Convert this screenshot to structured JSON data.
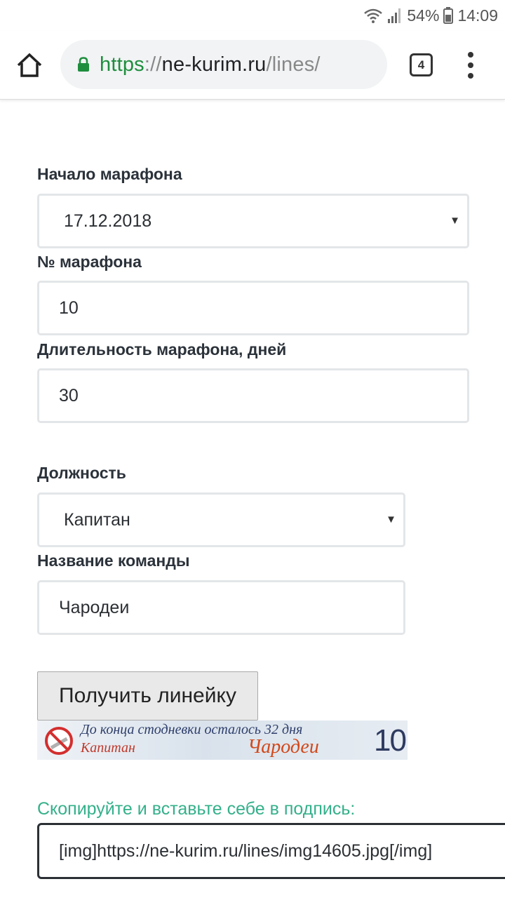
{
  "status_bar": {
    "battery": "54%",
    "time": "14:09"
  },
  "browser": {
    "url_scheme": "https",
    "url_separator": "://",
    "url_host": "ne-kurim.ru",
    "url_path": "/lines/",
    "tab_count": "4"
  },
  "form": {
    "start_label": "Начало марафона",
    "start_value": "17.12.2018",
    "number_label": "№ марафона",
    "number_value": "10",
    "duration_label": "Длительность марафона, дней",
    "duration_value": "30",
    "position_label": "Должность",
    "position_value": "Капитан",
    "team_label": "Название команды",
    "team_value": "Чародеи",
    "submit_label": "Получить линейку"
  },
  "banner": {
    "line1": "До конца стодневки осталось 32 дня",
    "position": "Капитан",
    "team": "Чародеи",
    "number": "10"
  },
  "copy": {
    "hint": "Скопируйте и вставьте себе в подпись:",
    "code": "[img]https://ne-kurim.ru/lines/img14605.jpg[/img]"
  },
  "colors": {
    "accent_green": "#34b08a",
    "lock_green": "#1e8e3e"
  }
}
